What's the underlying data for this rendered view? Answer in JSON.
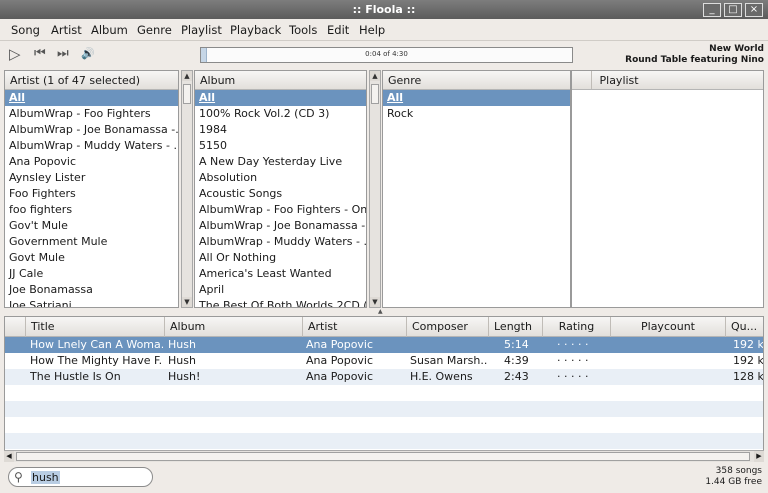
{
  "window": {
    "title": ":: Floola ::",
    "btn_min": "_",
    "btn_max": "□",
    "btn_close": "×"
  },
  "menu": [
    "Song",
    "Artist",
    "Album",
    "Genre",
    "Playlist",
    "Playback",
    "Tools",
    "Edit",
    "Help"
  ],
  "toolbar": {
    "play_icon": "▷",
    "prev_icon": "⏮",
    "next_icon": "⏭",
    "volume_icon": "🔊"
  },
  "progress": {
    "text": "0:04 of 4:30",
    "fraction": 0.015
  },
  "now_playing": {
    "line1": "New World",
    "line2": "Round Table featuring Nino"
  },
  "artist_pane": {
    "header": "Artist (1 of 47 selected)",
    "items": [
      "All",
      "AlbumWrap - Foo Fighters",
      "AlbumWrap - Joe Bonamassa -...",
      "AlbumWrap - Muddy Waters - ...",
      "Ana Popovic",
      "Aynsley Lister",
      "Foo Fighters",
      "foo fighters",
      "Gov't Mule",
      "Government Mule",
      "Govt Mule",
      "JJ Cale",
      "Joe Bonamassa",
      "Joe Satriani"
    ]
  },
  "album_pane": {
    "header": "Album",
    "items": [
      "All",
      "100% Rock Vol.2 (CD 3)",
      "1984",
      "5150",
      "A New Day Yesterday Live",
      "Absolution",
      "Acoustic Songs",
      "AlbumWrap - Foo Fighters - On...",
      "AlbumWrap - Joe Bonamassa -...",
      "AlbumWrap - Muddy Waters - ...",
      "All Or Nothing",
      "America's Least Wanted",
      "April",
      "The Best Of Both Worlds 2CD (P..."
    ]
  },
  "genre_pane": {
    "header": "Genre",
    "items": [
      "All",
      "Rock"
    ]
  },
  "playlist_pane": {
    "header": "Playlist"
  },
  "tracks": {
    "columns": [
      "Title",
      "Album",
      "Artist",
      "Composer",
      "Length",
      "Rating",
      "Playcount",
      "Qu..."
    ],
    "rows": [
      {
        "title": "How Lnely Can A Woma...",
        "album": "Hush",
        "artist": "Ana Popovic",
        "composer": "",
        "length": "5:14",
        "rating": "· · · · ·",
        "playcount": "",
        "quality": "192 k"
      },
      {
        "title": "How The Mighty Have F...",
        "album": "Hush",
        "artist": "Ana Popovic",
        "composer": "Susan Marsh...",
        "length": "4:39",
        "rating": "· · · · ·",
        "playcount": "",
        "quality": "192 k"
      },
      {
        "title": "The Hustle Is On",
        "album": "Hush!",
        "artist": "Ana Popovic",
        "composer": "H.E. Owens",
        "length": "2:43",
        "rating": "· · · · ·",
        "playcount": "",
        "quality": "128 k"
      }
    ]
  },
  "search": {
    "value": "hush",
    "icon": "search-icon"
  },
  "status": {
    "songs": "358 songs",
    "free": "1.44 GB free"
  }
}
